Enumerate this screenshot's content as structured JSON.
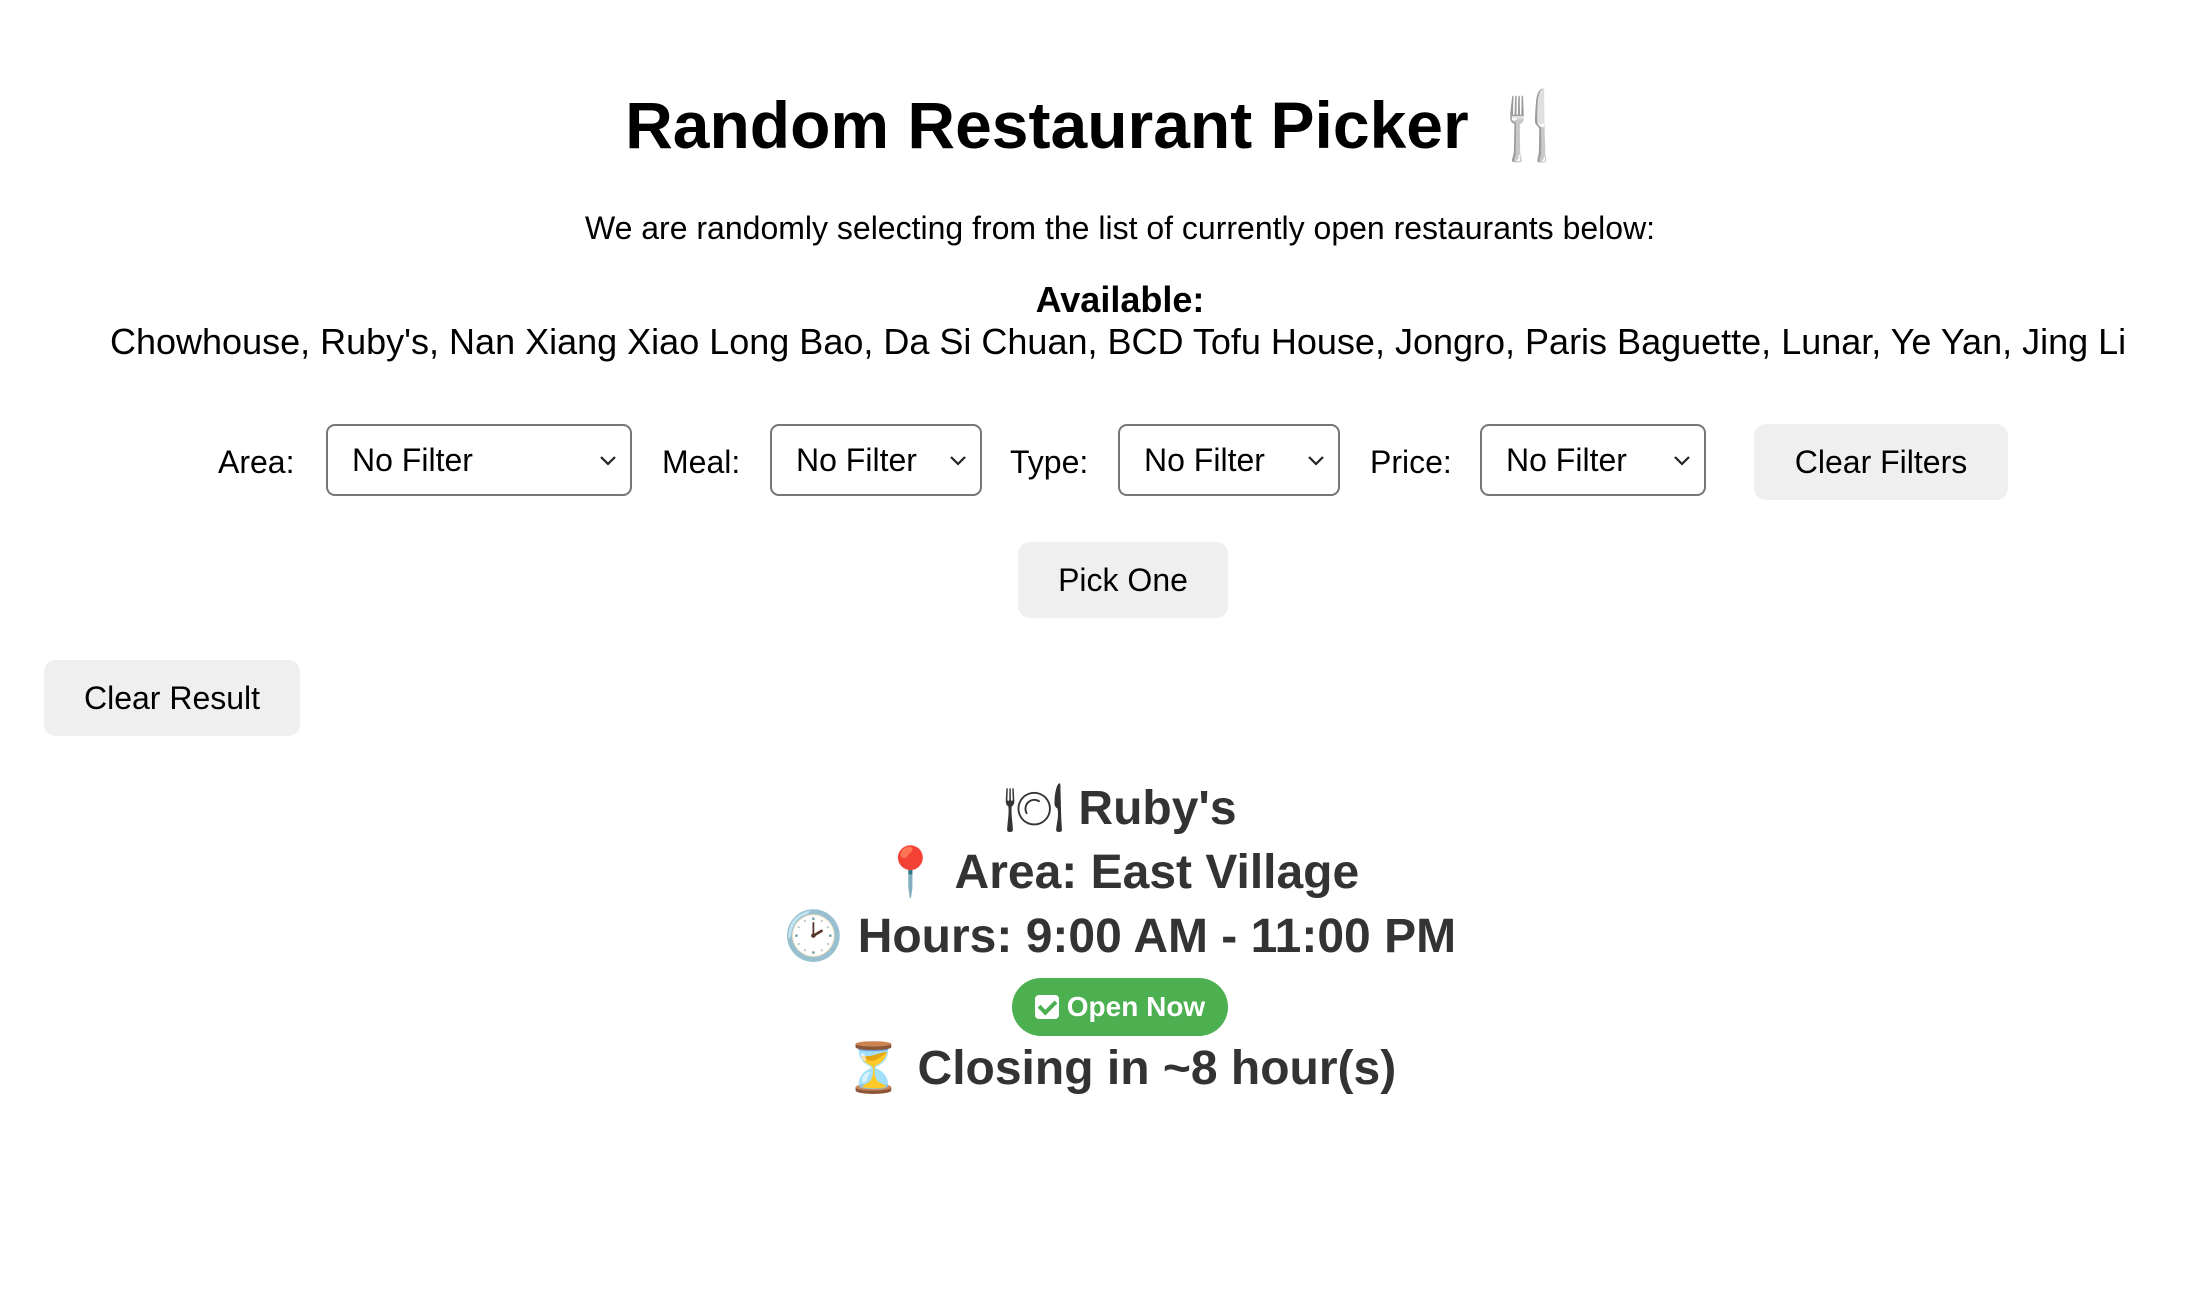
{
  "header": {
    "title": "Random Restaurant Picker",
    "title_icon": "fork-and-knife-icon",
    "subtitle": "We are randomly selecting from the list of currently open restaurants below:"
  },
  "available": {
    "label": "Available:",
    "list": "Chowhouse, Ruby's, Nan Xiang Xiao Long Bao, Da Si Chuan, BCD Tofu House, Jongro, Paris Baguette, Lunar, Ye Yan, Jing Li"
  },
  "filters": {
    "area": {
      "label": "Area:",
      "selected": "No Filter"
    },
    "meal": {
      "label": "Meal:",
      "selected": "No Filter"
    },
    "type": {
      "label": "Type:",
      "selected": "No Filter"
    },
    "price": {
      "label": "Price:",
      "selected": "No Filter"
    },
    "clear_label": "Clear Filters"
  },
  "actions": {
    "pick_label": "Pick One",
    "clear_result_label": "Clear Result"
  },
  "result": {
    "name": "Ruby's",
    "name_icon": "plate-icon",
    "area": "Area: East Village",
    "area_icon": "pin-icon",
    "hours": "Hours: 9:00 AM - 11:00 PM",
    "hours_icon": "clock-icon",
    "status": "Open Now",
    "status_icon": "checkmark-icon",
    "status_color": "#4caf50",
    "closing": "Closing in ~8 hour(s)",
    "closing_icon": "hourglass-icon"
  }
}
